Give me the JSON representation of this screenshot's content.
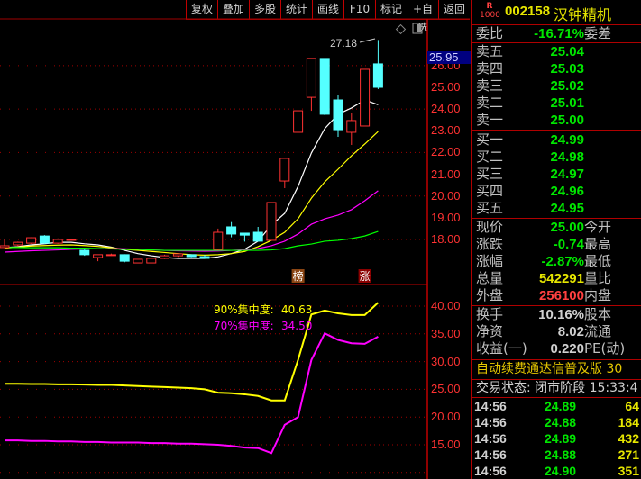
{
  "toolbar": {
    "items": [
      "复权",
      "叠加",
      "多股",
      "统计",
      "画线",
      "F10",
      "标记",
      "+自选",
      "返回"
    ]
  },
  "chart": {
    "high_annotation": "27.18",
    "crosshair_price": "25.95",
    "price_axis": [
      "26.00",
      "25.00",
      "24.00",
      "23.00",
      "22.00",
      "21.00",
      "20.00",
      "19.00",
      "18.00"
    ],
    "candles": [
      [
        17.63,
        18.0,
        17.6,
        17.71
      ],
      [
        17.75,
        17.9,
        17.7,
        17.87
      ],
      [
        17.83,
        18.1,
        17.8,
        18.08
      ],
      [
        18.16,
        18.2,
        17.8,
        17.83
      ],
      [
        17.83,
        18.05,
        17.8,
        18.0
      ],
      [
        17.96,
        18.02,
        17.94,
        18.0
      ],
      [
        17.5,
        17.55,
        17.25,
        17.3
      ],
      [
        17.17,
        17.3,
        17.0,
        17.3
      ],
      [
        17.27,
        17.35,
        17.25,
        17.3
      ],
      [
        17.3,
        17.32,
        16.95,
        17.0
      ],
      [
        16.92,
        17.09,
        16.9,
        17.09
      ],
      [
        16.92,
        17.13,
        16.9,
        17.13
      ],
      [
        17.13,
        17.3,
        17.1,
        17.25
      ],
      [
        17.25,
        17.36,
        17.2,
        17.34
      ],
      [
        17.3,
        17.32,
        17.18,
        17.21
      ],
      [
        17.21,
        17.3,
        17.12,
        17.13
      ],
      [
        17.54,
        18.5,
        17.5,
        18.33
      ],
      [
        18.58,
        18.8,
        18.1,
        18.25
      ],
      [
        18.29,
        18.3,
        17.9,
        18.2
      ],
      [
        18.33,
        18.58,
        17.9,
        17.92
      ],
      [
        17.96,
        19.7,
        17.96,
        19.7
      ],
      [
        20.69,
        21.73,
        20.36,
        21.73
      ],
      [
        22.93,
        23.92,
        22.93,
        23.92
      ],
      [
        24.54,
        26.33,
        23.92,
        26.33
      ],
      [
        26.33,
        26.33,
        23.72,
        23.76
      ],
      [
        24.42,
        24.67,
        22.72,
        23.05
      ],
      [
        22.93,
        23.8,
        22.35,
        23.47
      ],
      [
        23.22,
        25.83,
        23.22,
        25.83
      ],
      [
        26.08,
        27.18,
        24.92,
        25.0
      ]
    ],
    "ma": [
      {
        "color": "#ffffff",
        "values": [
          17.63,
          17.67,
          17.75,
          17.8,
          17.87,
          17.87,
          17.8,
          17.75,
          17.65,
          17.5,
          17.35,
          17.25,
          17.17,
          17.13,
          17.13,
          17.13,
          17.2,
          17.35,
          17.55,
          17.92,
          18.66,
          19.2,
          20.44,
          21.98,
          23.1,
          23.76,
          24.05,
          24.42,
          24.2
        ]
      },
      {
        "color": "#ffff00",
        "values": [
          17.6,
          17.65,
          17.7,
          17.72,
          17.74,
          17.75,
          17.72,
          17.68,
          17.62,
          17.55,
          17.5,
          17.45,
          17.4,
          17.35,
          17.3,
          17.28,
          17.3,
          17.35,
          17.45,
          17.67,
          17.96,
          18.33,
          18.95,
          19.9,
          20.65,
          21.23,
          21.85,
          22.39,
          22.97
        ]
      },
      {
        "color": "#ff00ff",
        "values": [
          17.42,
          17.45,
          17.48,
          17.5,
          17.52,
          17.55,
          17.57,
          17.58,
          17.58,
          17.57,
          17.55,
          17.52,
          17.5,
          17.48,
          17.47,
          17.46,
          17.47,
          17.5,
          17.53,
          17.58,
          17.71,
          17.92,
          18.25,
          18.7,
          18.95,
          19.12,
          19.37,
          19.78,
          20.24
        ]
      },
      {
        "color": "#00ff00",
        "values": [
          17.63,
          17.63,
          17.62,
          17.62,
          17.62,
          17.6,
          17.6,
          17.58,
          17.57,
          17.55,
          17.54,
          17.52,
          17.5,
          17.5,
          17.5,
          17.5,
          17.5,
          17.5,
          17.5,
          17.5,
          17.52,
          17.58,
          17.71,
          17.79,
          17.92,
          17.96,
          18.04,
          18.16,
          18.37
        ]
      }
    ],
    "markers": [
      {
        "index": 22,
        "text": "榜",
        "color": "#8b4513"
      },
      {
        "index": 27,
        "text": "涨",
        "color": "#8b0000"
      }
    ],
    "up_color": "#ff3232",
    "down_color": "#54ffff"
  },
  "indicator": {
    "axis": [
      "40.00",
      "35.00",
      "30.00",
      "25.00",
      "20.00",
      "15.00"
    ],
    "series": [
      {
        "label": "90%集中度:",
        "value": "40.63",
        "color": "#ffff00",
        "values": [
          26.0,
          26.0,
          25.95,
          25.95,
          25.9,
          25.9,
          25.85,
          25.8,
          25.8,
          25.7,
          25.6,
          25.5,
          25.4,
          25.3,
          25.2,
          25.0,
          24.4,
          24.3,
          24.1,
          23.8,
          23.0,
          23.0,
          30.3,
          38.5,
          39.2,
          38.7,
          38.4,
          38.4,
          40.63
        ]
      },
      {
        "label": "70%集中度:",
        "value": "34.50",
        "color": "#ff00ff",
        "values": [
          15.8,
          15.8,
          15.7,
          15.7,
          15.6,
          15.6,
          15.5,
          15.5,
          15.4,
          15.4,
          15.4,
          15.3,
          15.3,
          15.2,
          15.2,
          15.1,
          15.0,
          14.8,
          14.5,
          14.4,
          13.5,
          18.6,
          20.0,
          30.3,
          35.1,
          33.9,
          33.3,
          33.2,
          34.5
        ]
      }
    ]
  },
  "panel": {
    "badge_top": "R",
    "badge_bottom": "1000",
    "code": "002158",
    "name": "汉钟精机",
    "weibi": {
      "label": "委比",
      "value": "-16.71%",
      "label2": "委差"
    },
    "asks": [
      {
        "label": "卖五",
        "price": "25.04"
      },
      {
        "label": "卖四",
        "price": "25.03"
      },
      {
        "label": "卖三",
        "price": "25.02"
      },
      {
        "label": "卖二",
        "price": "25.01"
      },
      {
        "label": "卖一",
        "price": "25.00"
      }
    ],
    "bids": [
      {
        "label": "买一",
        "price": "24.99"
      },
      {
        "label": "买二",
        "price": "24.98"
      },
      {
        "label": "买三",
        "price": "24.97"
      },
      {
        "label": "买四",
        "price": "24.96"
      },
      {
        "label": "买五",
        "price": "24.95"
      }
    ],
    "stats": [
      {
        "label": "现价",
        "value": "25.00",
        "label2": "今开"
      },
      {
        "label": "涨跌",
        "value": "-0.74",
        "label2": "最高"
      },
      {
        "label": "涨幅",
        "value": "-2.87%",
        "label2": "最低"
      },
      {
        "label": "总量",
        "value": "542291",
        "label2": "量比"
      },
      {
        "label": "外盘",
        "value": "256100",
        "label2": "内盘"
      }
    ],
    "fin": [
      {
        "label": "换手",
        "value": "10.16%",
        "label2": "股本"
      },
      {
        "label": "净资",
        "value": "8.02",
        "label2": "流通"
      },
      {
        "label": "收益(一)",
        "value": "0.220",
        "label2": "PE(动)"
      }
    ],
    "promo": "自动续费通达信普及版  30",
    "status": "交易状态: 闭市阶段 15:33:4",
    "ticks": [
      {
        "time": "14:56",
        "price": "24.89",
        "vol": "64"
      },
      {
        "time": "14:56",
        "price": "24.88",
        "vol": "184"
      },
      {
        "time": "14:56",
        "price": "24.89",
        "vol": "432"
      },
      {
        "time": "14:56",
        "price": "24.88",
        "vol": "271"
      },
      {
        "time": "14:56",
        "price": "24.90",
        "vol": "351"
      }
    ]
  }
}
